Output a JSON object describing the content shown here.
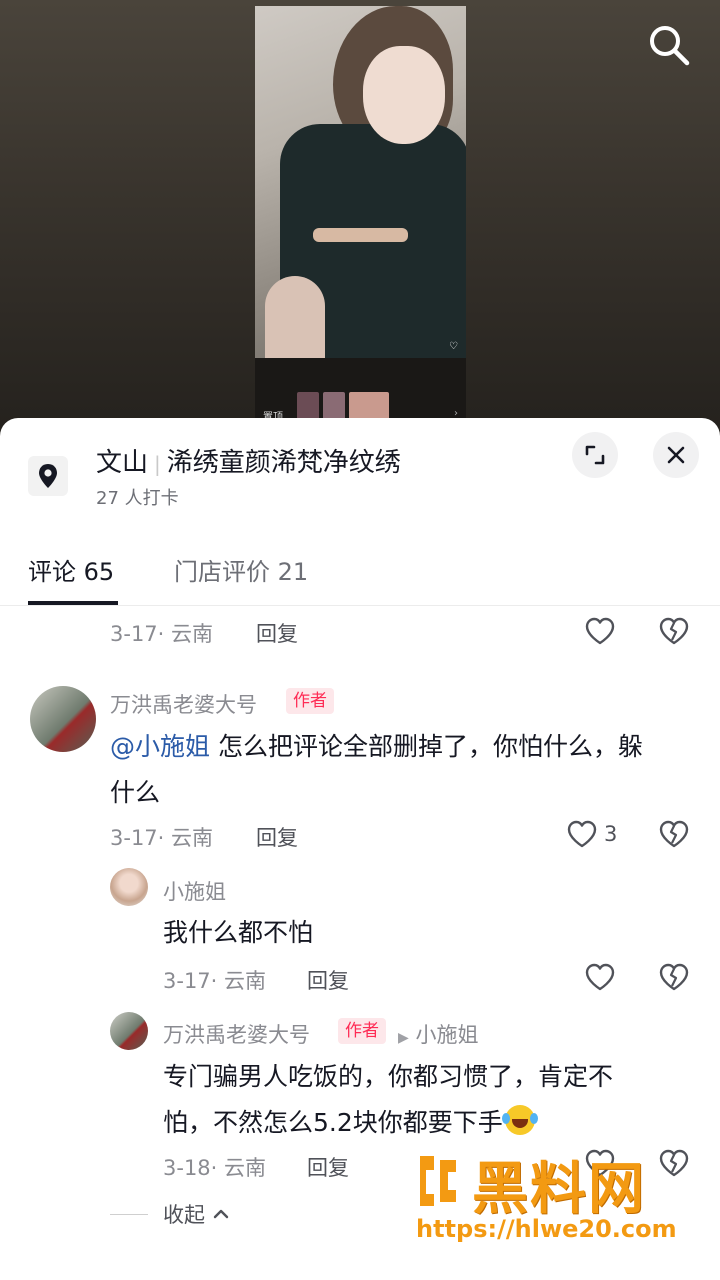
{
  "location": {
    "city": "文山",
    "store_name": "浠绣童颜浠梵净纹绣",
    "checkins": "27 人打卡"
  },
  "tabs": [
    {
      "label": "评论 65",
      "active": true
    },
    {
      "label": "门店评价 21",
      "active": false
    }
  ],
  "video": {
    "pinned_label": "置顶"
  },
  "comments": {
    "prev_meta": "3-17· 云南",
    "reply_label": "回复",
    "main": {
      "username": "万洪禹老婆大号",
      "badge": "作者",
      "mention": "@小施姐",
      "text_line1": " 怎么把评论全部删掉了，你怕什么，躲",
      "text_line2": "什么",
      "meta": "3-17· 云南",
      "likes": "3"
    },
    "reply1": {
      "username": "小施姐",
      "text": "我什么都不怕",
      "meta": "3-17· 云南"
    },
    "reply2": {
      "username": "万洪禹老婆大号",
      "badge": "作者",
      "reply_to": "小施姐",
      "text_line1": "专门骗男人吃饭的，你都习惯了，肯定不",
      "text_line2": "怕，不然怎么5.2块你都要下手",
      "meta": "3-18· 云南"
    },
    "collapse_label": "收起"
  },
  "watermark": {
    "brand": "黑料网",
    "url": "https://hlwe20.com"
  },
  "colors": {
    "accent": "#fe2c55",
    "mention": "#2b5ba8",
    "watermark": "#f39a12"
  }
}
